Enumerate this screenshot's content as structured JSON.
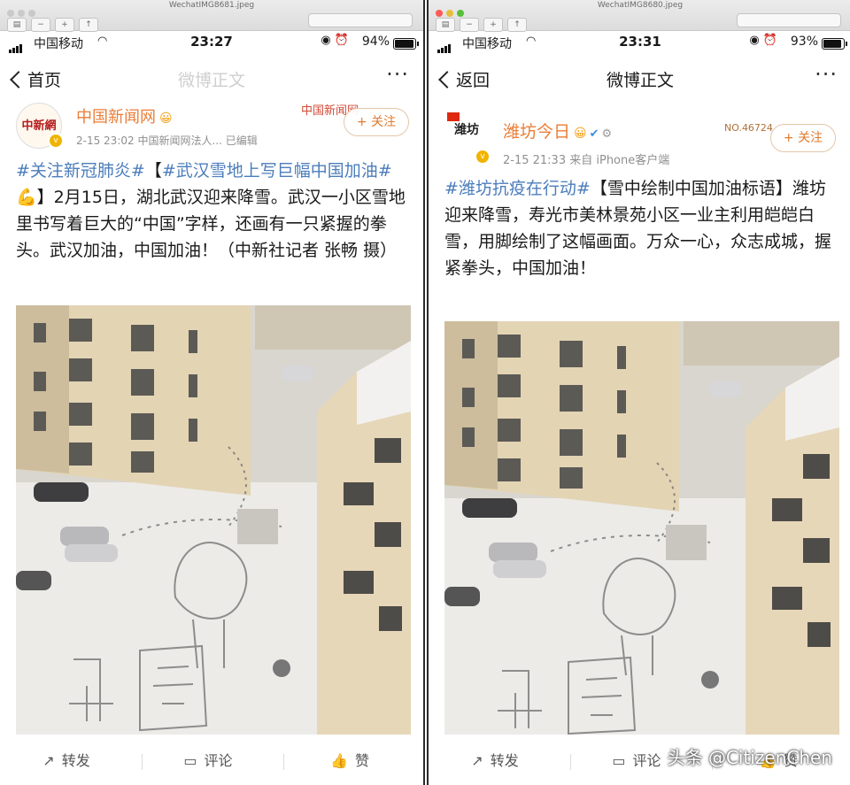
{
  "left": {
    "window": {
      "filename": "WechatIMG8681.jpeg"
    },
    "status": {
      "carrier": "中国移动",
      "time": "23:27",
      "battery_text": "94%",
      "battery_level": 0.94
    },
    "nav": {
      "back_label": "首页",
      "title": "微博正文"
    },
    "post": {
      "author": "中国新闻网",
      "avatar_text": "中新網",
      "meta": "2-15 23:02 中国新闻网法人... 已编辑",
      "follow_label": "+ 关注",
      "fans_badge": "中国新闻网",
      "body_hash1": "#关注新冠肺炎#",
      "body_bracket": "【",
      "body_hash2": "#武汉雪地上写巨幅中国加油#",
      "body_text": "💪】2月15日，湖北武汉迎来降雪。武汉一小区雪地里书写着巨大的“中国”字样，还画有一只紧握的拳头。武汉加油，中国加油！（中新社记者 张畅 摄）"
    },
    "actions": {
      "repost": "转发",
      "comment": "评论",
      "like": "赞"
    }
  },
  "right": {
    "window": {
      "filename": "WechatIMG8680.jpeg"
    },
    "status": {
      "carrier": "中国移动",
      "time": "23:31",
      "battery_text": "93%",
      "battery_level": 0.93
    },
    "nav": {
      "back_label": "返回",
      "title": "微博正文"
    },
    "post": {
      "author": "潍坊今日",
      "avatar_text": "潍坊",
      "meta": "2-15 21:33 来自 iPhone客户端",
      "follow_label": "+ 关注",
      "fans_badge": "NO.46724",
      "body_hash1": "#潍坊抗疫在行动#",
      "body_text": "【雪中绘制中国加油标语】潍坊迎来降雪，寿光市美林景苑小区一业主利用皑皑白雪，用脚绘制了这幅画面。万众一心，众志成城，握紧拳头，中国加油！"
    },
    "actions": {
      "repost": "转发",
      "comment": "评论",
      "like": "赞"
    }
  },
  "watermark": "头条 @CitizenChen",
  "icons": {
    "signal": "signal-bars-icon",
    "wifi": "wifi-icon",
    "battery": "battery-icon",
    "back": "chevron-left-icon",
    "more": "more-dots-icon",
    "verified": "verified-badge-icon",
    "repost": "repost-icon",
    "comment": "comment-icon",
    "like": "thumbs-up-icon"
  },
  "colors": {
    "author": "#eb7d36",
    "hashtag": "#4c7dbb",
    "follow": "#e07a2e"
  }
}
